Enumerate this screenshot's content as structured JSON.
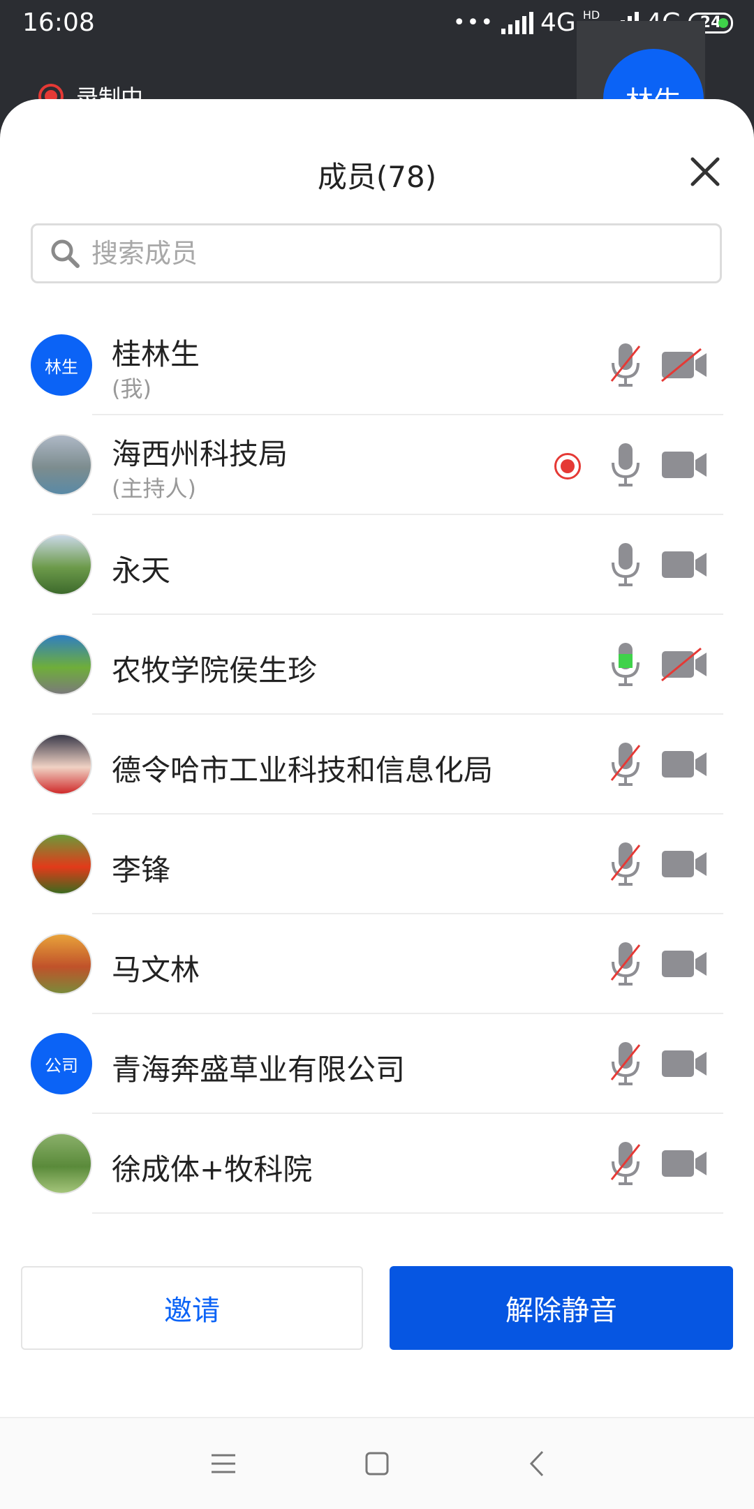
{
  "status_bar": {
    "time": "16:08",
    "dots": "•••",
    "network1": "4G",
    "network2_prefix": "HD",
    "network2": "4G",
    "battery": "24"
  },
  "background": {
    "recording_label": "录制中",
    "self_avatar_text": "林生"
  },
  "sheet": {
    "title": "成员(78)",
    "search_placeholder": "搜索成员"
  },
  "members": [
    {
      "name": "桂林生",
      "role": "(我)",
      "avatar_text": "林生",
      "avatar_type": "text",
      "recording": false,
      "mic": "muted",
      "camera": "off"
    },
    {
      "name": "海西州科技局",
      "role": "(主持人)",
      "avatar_type": "photo",
      "avatar_colors": [
        "#aeb8c6",
        "#7c8c8e",
        "#5a8aa6"
      ],
      "recording": true,
      "mic": "on",
      "camera": "on"
    },
    {
      "name": "永天",
      "role": "",
      "avatar_type": "photo",
      "avatar_colors": [
        "#c9d8e6",
        "#6c9a4a",
        "#3d6a2c"
      ],
      "recording": false,
      "mic": "on",
      "camera": "on"
    },
    {
      "name": "农牧学院侯生珍",
      "role": "",
      "avatar_type": "photo",
      "avatar_colors": [
        "#2f7ec2",
        "#6fae3a",
        "#7a7a7a"
      ],
      "recording": false,
      "mic": "speaking",
      "camera": "off"
    },
    {
      "name": "德令哈市工业科技和信息化局",
      "role": "",
      "avatar_type": "photo",
      "avatar_colors": [
        "#3a3a4a",
        "#f0d2c4",
        "#cf2a2a"
      ],
      "recording": false,
      "mic": "muted",
      "camera": "on"
    },
    {
      "name": "李锋",
      "role": "",
      "avatar_type": "photo",
      "avatar_colors": [
        "#6c9a3a",
        "#e23a1a",
        "#3c6a1e"
      ],
      "recording": false,
      "mic": "muted",
      "camera": "on"
    },
    {
      "name": "马文林",
      "role": "",
      "avatar_type": "photo",
      "avatar_colors": [
        "#e8a23a",
        "#c0522a",
        "#7a8a3a"
      ],
      "recording": false,
      "mic": "muted",
      "camera": "on"
    },
    {
      "name": "青海奔盛草业有限公司",
      "role": "",
      "avatar_text": "公司",
      "avatar_type": "text",
      "recording": false,
      "mic": "muted",
      "camera": "on"
    },
    {
      "name": "徐成体+牧科院",
      "role": "",
      "avatar_type": "photo",
      "avatar_colors": [
        "#8ab06a",
        "#5a8a3a",
        "#a4c47a"
      ],
      "recording": false,
      "mic": "muted",
      "camera": "on"
    }
  ],
  "buttons": {
    "invite": "邀请",
    "unmute_all": "解除静音"
  },
  "nav": {
    "icons": [
      "menu-icon",
      "home-square-icon",
      "back-chevron-icon"
    ]
  },
  "colors": {
    "accent": "#0656e2",
    "record_red": "#e53935",
    "speaking_green": "#3fd24a",
    "icon_gray": "#8e8e93"
  }
}
